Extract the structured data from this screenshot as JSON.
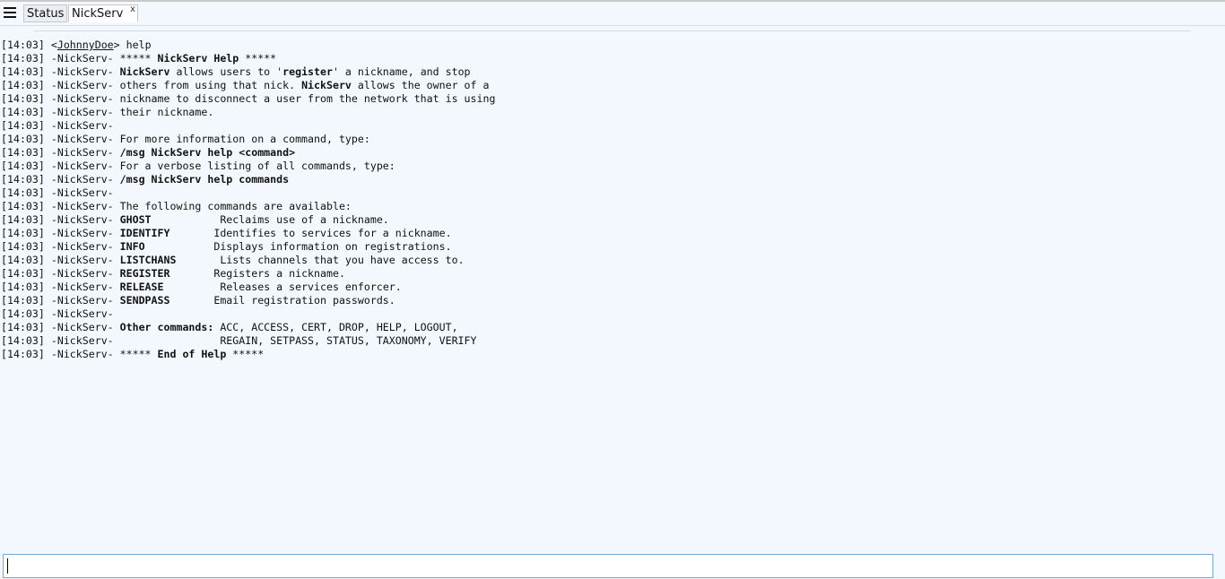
{
  "tabs": [
    {
      "label": "Status",
      "active": false
    },
    {
      "label": "NickServ",
      "active": true,
      "close": "x"
    }
  ],
  "input": {
    "value": "",
    "placeholder": ""
  },
  "log": [
    {
      "ts": "[14:03]",
      "pre": " <",
      "nick": "JohnnyDoe",
      "post": "> help"
    },
    {
      "ts": "[14:03]",
      "src": " -NickServ- ",
      "parts": [
        {
          "t": "***** "
        },
        {
          "t": "NickServ Help",
          "b": true
        },
        {
          "t": " *****"
        }
      ]
    },
    {
      "ts": "[14:03]",
      "src": " -NickServ- ",
      "parts": [
        {
          "t": "NickServ",
          "b": true
        },
        {
          "t": " allows users to '"
        },
        {
          "t": "register",
          "b": true
        },
        {
          "t": "' a nickname, and stop"
        }
      ]
    },
    {
      "ts": "[14:03]",
      "src": " -NickServ- ",
      "parts": [
        {
          "t": "others from using that nick. "
        },
        {
          "t": "NickServ",
          "b": true
        },
        {
          "t": " allows the owner of a"
        }
      ]
    },
    {
      "ts": "[14:03]",
      "src": " -NickServ- ",
      "parts": [
        {
          "t": "nickname to disconnect a user from the network that is using"
        }
      ]
    },
    {
      "ts": "[14:03]",
      "src": " -NickServ- ",
      "parts": [
        {
          "t": "their nickname."
        }
      ]
    },
    {
      "ts": "[14:03]",
      "src": " -NickServ- ",
      "parts": []
    },
    {
      "ts": "[14:03]",
      "src": " -NickServ- ",
      "parts": [
        {
          "t": "For more information on a command, type:"
        }
      ]
    },
    {
      "ts": "[14:03]",
      "src": " -NickServ- ",
      "parts": [
        {
          "t": "/msg NickServ help <command>",
          "b": true
        }
      ]
    },
    {
      "ts": "[14:03]",
      "src": " -NickServ- ",
      "parts": [
        {
          "t": "For a verbose listing of all commands, type:"
        }
      ]
    },
    {
      "ts": "[14:03]",
      "src": " -NickServ- ",
      "parts": [
        {
          "t": "/msg NickServ help commands",
          "b": true
        }
      ]
    },
    {
      "ts": "[14:03]",
      "src": " -NickServ- ",
      "parts": []
    },
    {
      "ts": "[14:03]",
      "src": " -NickServ- ",
      "parts": [
        {
          "t": "The following commands are available:"
        }
      ]
    },
    {
      "ts": "[14:03]",
      "src": " -NickServ- ",
      "parts": [
        {
          "t": "GHOST",
          "b": true
        },
        {
          "t": "           Reclaims use of a nickname."
        }
      ]
    },
    {
      "ts": "[14:03]",
      "src": " -NickServ- ",
      "parts": [
        {
          "t": "IDENTIFY",
          "b": true
        },
        {
          "t": "       Identifies to services for a nickname."
        }
      ]
    },
    {
      "ts": "[14:03]",
      "src": " -NickServ- ",
      "parts": [
        {
          "t": "INFO",
          "b": true
        },
        {
          "t": "           Displays information on registrations."
        }
      ]
    },
    {
      "ts": "[14:03]",
      "src": " -NickServ- ",
      "parts": [
        {
          "t": "LISTCHANS",
          "b": true
        },
        {
          "t": "       Lists channels that you have access to."
        }
      ]
    },
    {
      "ts": "[14:03]",
      "src": " -NickServ- ",
      "parts": [
        {
          "t": "REGISTER",
          "b": true
        },
        {
          "t": "       Registers a nickname."
        }
      ]
    },
    {
      "ts": "[14:03]",
      "src": " -NickServ- ",
      "parts": [
        {
          "t": "RELEASE",
          "b": true
        },
        {
          "t": "         Releases a services enforcer."
        }
      ]
    },
    {
      "ts": "[14:03]",
      "src": " -NickServ- ",
      "parts": [
        {
          "t": "SENDPASS",
          "b": true
        },
        {
          "t": "       Email registration passwords."
        }
      ]
    },
    {
      "ts": "[14:03]",
      "src": " -NickServ- ",
      "parts": []
    },
    {
      "ts": "[14:03]",
      "src": " -NickServ- ",
      "parts": [
        {
          "t": "Other commands:",
          "b": true
        },
        {
          "t": " ACC, ACCESS, CERT, DROP, HELP, LOGOUT,"
        }
      ]
    },
    {
      "ts": "[14:03]",
      "src": " -NickServ- ",
      "parts": [
        {
          "t": "                REGAIN, SETPASS, STATUS, TAXONOMY, VERIFY"
        }
      ]
    },
    {
      "ts": "[14:03]",
      "src": " -NickServ- ",
      "parts": [
        {
          "t": "***** "
        },
        {
          "t": "End of Help",
          "b": true
        },
        {
          "t": " *****"
        }
      ]
    }
  ]
}
